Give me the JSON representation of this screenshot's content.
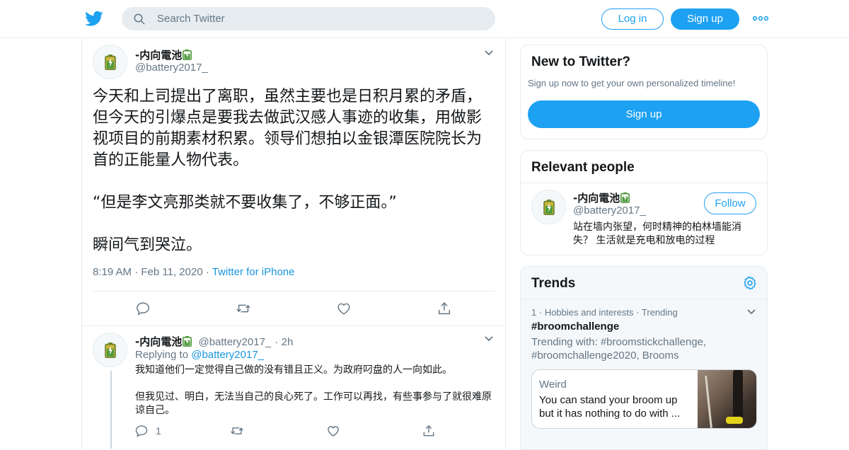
{
  "header": {
    "search_placeholder": "Search Twitter",
    "login_label": "Log in",
    "signup_label": "Sign up"
  },
  "tweet": {
    "author_name": "-内向電池",
    "author_handle": "@battery2017_",
    "text": "今天和上司提出了离职，虽然主要也是日积月累的矛盾，但今天的引爆点是要我去做武汉感人事迹的收集，用做影视项目的前期素材积累。领导们想拍以金银潭医院院长为首的正能量人物代表。\n\n“但是李文亮那类就不要收集了，不够正面。”\n\n瞬间气到哭泣。",
    "time": "8:19 AM",
    "date": "Feb 11, 2020",
    "source": "Twitter for iPhone"
  },
  "reply": {
    "author_name": "-内向電池",
    "author_handle": "@battery2017_",
    "age": "2h",
    "replying_prefix": "Replying to",
    "replying_to": "@battery2017_",
    "text": "我知道他们一定觉得自己做的没有错且正义。为政府叼盘的人一向如此。\n\n但我见过、明白，无法当自己的良心死了。工作可以再找，有些事参与了就很难原谅自己。",
    "reply_count": "1"
  },
  "sidebar": {
    "new_to_twitter": {
      "title": "New to Twitter?",
      "subtitle": "Sign up now to get your own personalized timeline!",
      "button": "Sign up"
    },
    "relevant_people": {
      "title": "Relevant people",
      "name": "-内向電池",
      "handle": "@battery2017_",
      "follow_label": "Follow",
      "bio": "站在墙内张望，何时精神的柏林墙能消失？ 生活就是充电和放电的过程"
    },
    "trends": {
      "title": "Trends",
      "rank": "1",
      "category": "Hobbies and interests",
      "status": "Trending",
      "name": "#broomchallenge",
      "trending_with": "Trending with: #broomstickchallenge, #broomchallenge2020, Brooms",
      "news_source": "Weird",
      "news_headline": "You can stand your broom up but it has nothing to do with ..."
    }
  },
  "colors": {
    "brand": "#1da1f2",
    "link": "#1b95e0",
    "secondary_text": "#657786",
    "border": "#e6ecf0"
  },
  "icons": [
    "twitter-bird-icon",
    "search-icon",
    "more-icon",
    "chevron-down-icon",
    "reply-icon",
    "retweet-icon",
    "like-icon",
    "share-icon",
    "battery-icon",
    "gear-icon"
  ]
}
